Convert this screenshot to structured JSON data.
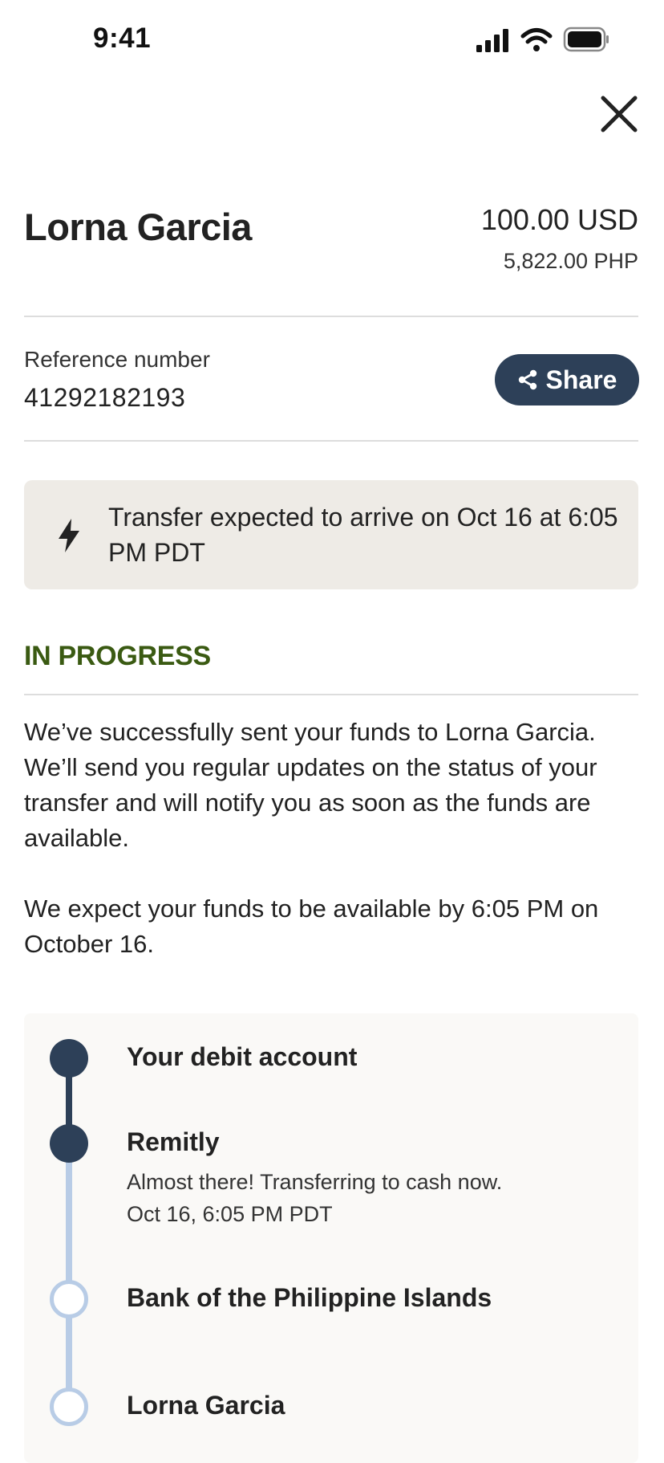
{
  "status_bar": {
    "time": "9:41",
    "icons": [
      "signal-icon",
      "wifi-icon",
      "battery-icon"
    ]
  },
  "header": {
    "close_icon": "close-icon"
  },
  "recipient": {
    "name": "Lorna Garcia",
    "amount_sent": "100.00 USD",
    "amount_received": "5,822.00 PHP"
  },
  "reference": {
    "label": "Reference number",
    "value": "41292182193",
    "share_label": "Share",
    "share_icon": "share-icon"
  },
  "eta": {
    "icon": "lightning-icon",
    "text": "Transfer expected to arrive on Oct 16 at 6:05 PM PDT"
  },
  "status": {
    "label": "IN PROGRESS",
    "message_1": "We’ve successfully sent your funds to Lorna Garcia. We’ll send you regular updates on the status of your transfer and will notify you as soon as the funds are available.",
    "message_2": "We expect your funds to be available by 6:05 PM on October 16."
  },
  "timeline": {
    "steps": [
      {
        "title": "Your debit account",
        "state": "complete"
      },
      {
        "title": "Remitly",
        "state": "complete",
        "detail_1": "Almost there! Transferring to cash now.",
        "detail_2": "Oct 16, 6:05 PM PDT"
      },
      {
        "title": "Bank of the Philippine Islands",
        "state": "pending"
      },
      {
        "title": "Lorna Garcia",
        "state": "pending"
      }
    ]
  },
  "colors": {
    "primary_navy": "#2d4058",
    "status_green": "#3a5a12",
    "eta_background": "#eeebe6",
    "pending_line": "#b8cce6"
  }
}
